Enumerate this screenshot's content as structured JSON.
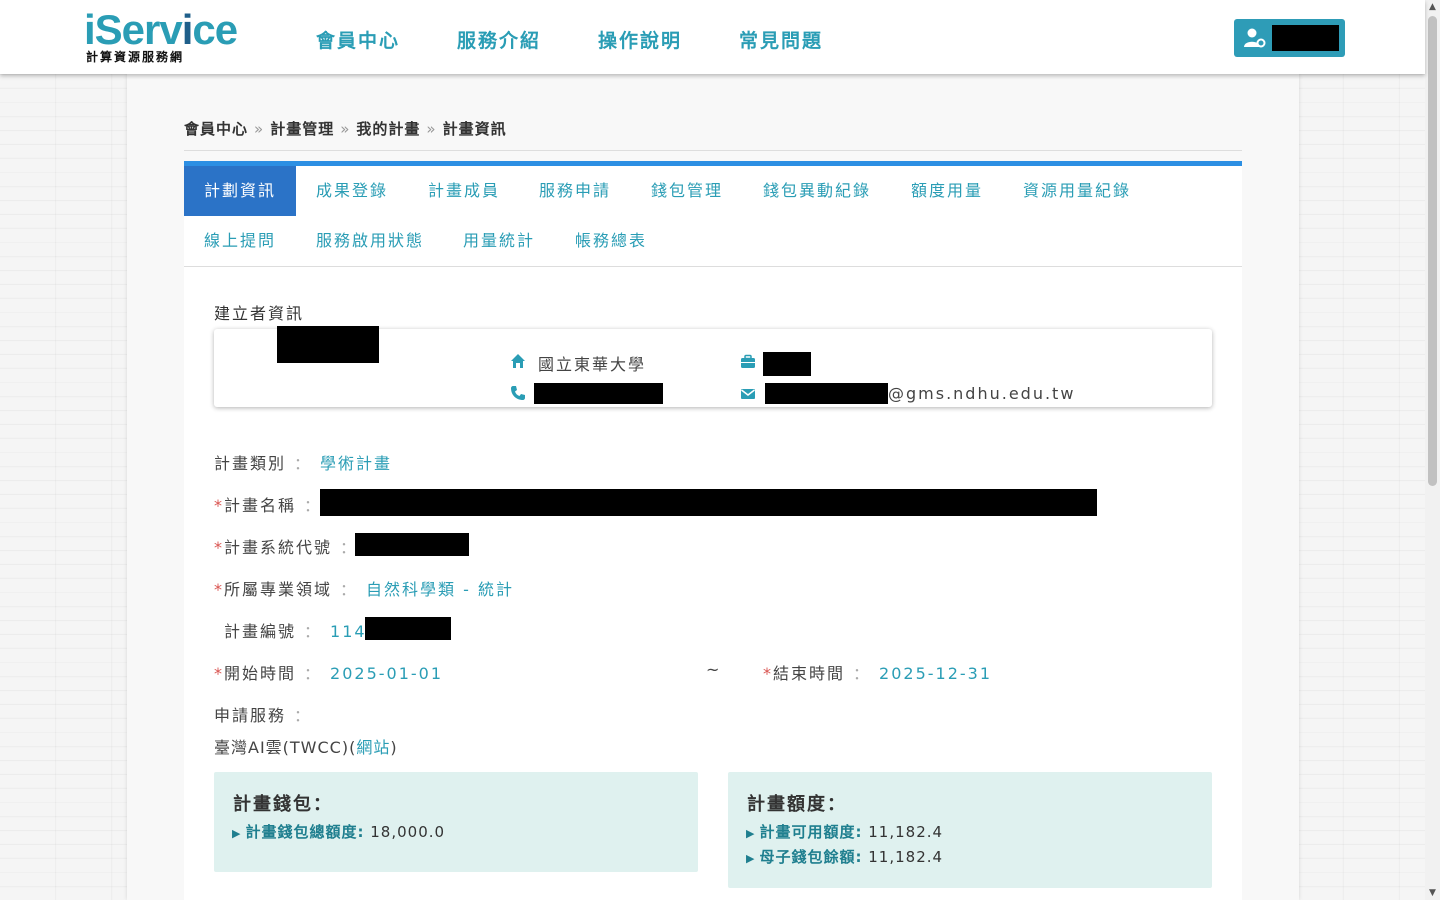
{
  "header": {
    "logo_main": "iServ",
    "logo_v": "i",
    "logo_end": "ce",
    "logo_sub": "計算資源服務網",
    "nav": [
      "會員中心",
      "服務介紹",
      "操作說明",
      "常見問題"
    ]
  },
  "breadcrumb": [
    "會員中心",
    "計畫管理",
    "我的計畫",
    "計畫資訊"
  ],
  "breadcrumb_sep": "»",
  "tabs_row1": [
    "計劃資訊",
    "成果登錄",
    "計畫成員",
    "服務申請",
    "錢包管理",
    "錢包異動紀錄",
    "額度用量",
    "資源用量紀錄"
  ],
  "tabs_row2": [
    "線上提問",
    "服務啟用狀態",
    "用量統計",
    "帳務總表"
  ],
  "creator": {
    "section_title": "建立者資訊",
    "institution": "國立東華大學",
    "email_domain": "@gms.ndhu.edu.tw"
  },
  "fields": {
    "category_label": "計畫類別",
    "category_value": "學術計畫",
    "name_label": "計畫名稱",
    "code_label": "計畫系統代號",
    "domain_label": "所屬專業領域",
    "domain_value": "自然科學類 - 統計",
    "number_label": "計畫編號",
    "number_value": "114T",
    "start_label": "開始時間",
    "start_value": "2025-01-01",
    "tilde": "~",
    "end_label": "結束時間",
    "end_value": "2025-12-31",
    "service_label": "申請服務",
    "service_value_prefix": "臺灣AI雲(TWCC)(",
    "service_link": "網站",
    "service_value_suffix": ")",
    "required_mark": "*",
    "colon": "："
  },
  "wallet": {
    "title": "計畫錢包：",
    "total_label": "計畫錢包總額度:",
    "total_value": "18,000.0"
  },
  "quota": {
    "title": "計畫額度：",
    "available_label": "計畫可用額度:",
    "available_value": "11,182.4",
    "balance_label": "母子錢包餘額:",
    "balance_value": "11,182.4"
  },
  "colors": {
    "accent": "#2a9db5",
    "tab_active": "#2b73c7",
    "panel_top": "#2c8fe3",
    "required": "#d9534f",
    "box_bg": "#dff1ef"
  }
}
